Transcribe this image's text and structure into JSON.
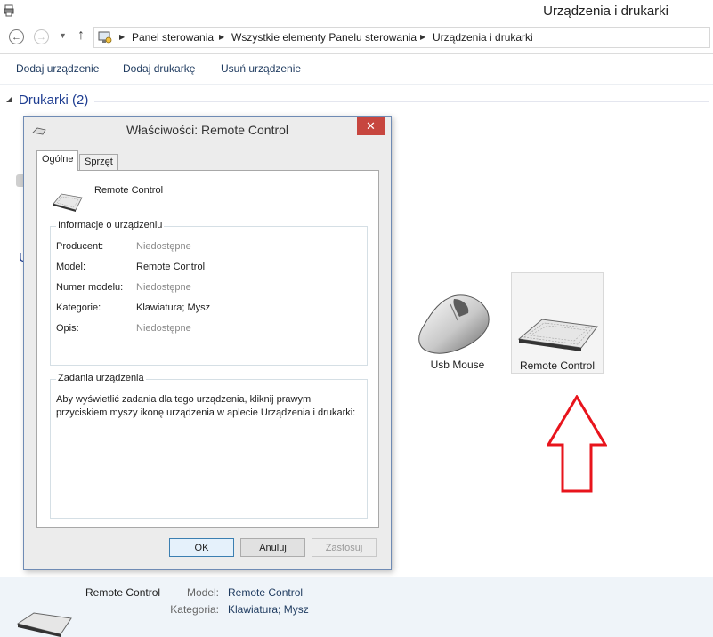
{
  "window": {
    "title": "Urządzenia i drukarki"
  },
  "address": {
    "crumbs": [
      "Panel sterowania",
      "Wszystkie elementy Panelu sterowania",
      "Urządzenia i drukarki"
    ]
  },
  "toolbar": {
    "add_device": "Dodaj urządzenie",
    "add_printer": "Dodaj drukarkę",
    "remove_device": "Usuń urządzenie"
  },
  "sections": {
    "printers": "Drukarki (2)",
    "devices_letter": "U"
  },
  "devices": [
    {
      "label": "Usb Mouse",
      "icon": "mouse-icon"
    },
    {
      "label": "Remote Control",
      "icon": "keyboard-icon",
      "selected": true
    }
  ],
  "details": {
    "name": "Remote Control",
    "model_key": "Model:",
    "model_val": "Remote Control",
    "category_key": "Kategoria:",
    "category_val": "Klawiatura; Mysz"
  },
  "dialog": {
    "title": "Właściwości: Remote Control",
    "close_glyph": "✕",
    "tabs": [
      "Ogólne",
      "Sprzęt"
    ],
    "device_name": "Remote Control",
    "info_group": "Informacje o urządzeniu",
    "info": [
      {
        "key": "Producent:",
        "value": "Niedostępne",
        "available": false
      },
      {
        "key": "Model:",
        "value": "Remote Control",
        "available": true
      },
      {
        "key": "Numer modelu:",
        "value": "Niedostępne",
        "available": false
      },
      {
        "key": "Kategorie:",
        "value": "Klawiatura; Mysz",
        "available": true
      },
      {
        "key": "Opis:",
        "value": "Niedostępne",
        "available": false
      }
    ],
    "tasks_group": "Zadania urządzenia",
    "tasks_text": "Aby wyświetlić zadania dla tego urządzenia, kliknij prawym przyciskiem myszy ikonę urządzenia w aplecie Urządzenia i drukarki:",
    "buttons": {
      "ok": "OK",
      "cancel": "Anuluj",
      "apply": "Zastosuj"
    }
  },
  "colors": {
    "accent_link": "#1e3d91",
    "close_red": "#c7463f",
    "arrow_red": "#e8141c",
    "details_bg": "#eff4f9"
  }
}
